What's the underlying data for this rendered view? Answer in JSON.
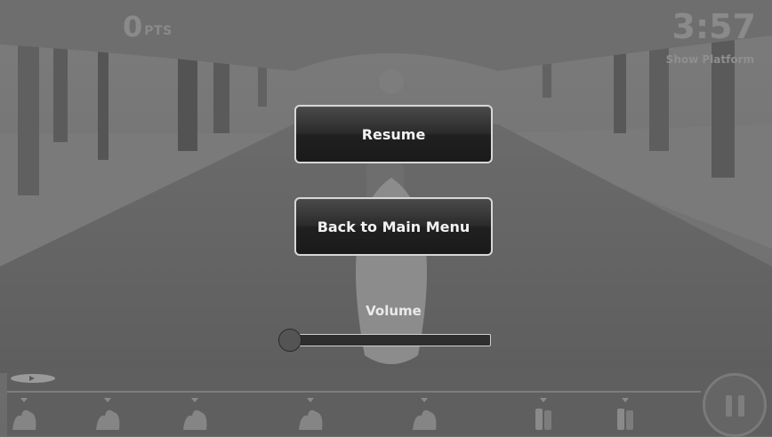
{
  "hud": {
    "points_value": "0",
    "points_unit": "PTS",
    "timer": "3:57",
    "platform_toggle": "Show Platform"
  },
  "pause_menu": {
    "resume_label": "Resume",
    "main_menu_label": "Back to Main Menu",
    "volume_label": "Volume",
    "volume_level": 0
  },
  "track": {
    "items": [
      {
        "icon": "rock-obstacle-icon"
      },
      {
        "icon": "rock-obstacle-icon"
      },
      {
        "icon": "rock-obstacle-icon"
      },
      {
        "icon": "rock-obstacle-icon"
      },
      {
        "icon": "rock-obstacle-icon"
      },
      {
        "icon": "bottle-pickup-icon"
      },
      {
        "icon": "bottle-pickup-icon"
      }
    ]
  },
  "icons": {
    "pause": "pause-icon",
    "progress_marker": "progress-marker-icon"
  }
}
